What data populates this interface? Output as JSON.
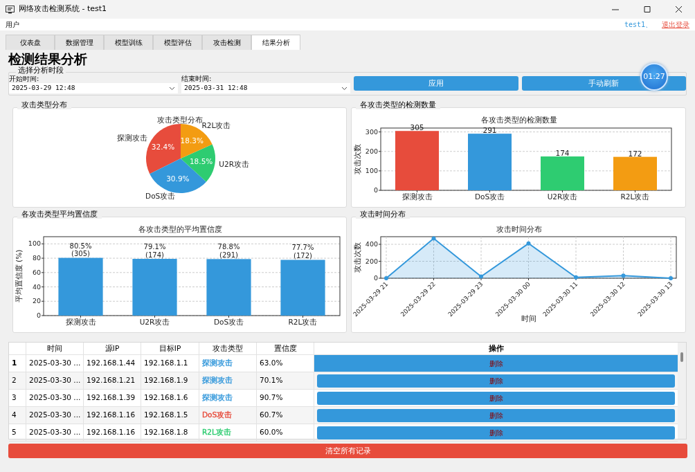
{
  "window": {
    "title": "网络攻击检测系统 - test1"
  },
  "menu_bar": {
    "items": [
      "用户"
    ],
    "user": "test1、",
    "logout": "退出登录"
  },
  "tabs": [
    {
      "label": "仪表盘",
      "selected": false
    },
    {
      "label": "数据管理",
      "selected": false
    },
    {
      "label": "模型训练",
      "selected": false
    },
    {
      "label": "模型评估",
      "selected": false
    },
    {
      "label": "攻击检测",
      "selected": false
    },
    {
      "label": "结果分析",
      "selected": true
    }
  ],
  "page_title": "检测结果分析",
  "period": {
    "title": "选择分析时段",
    "start_label": "开始时间:",
    "start_value": "2025-03-29 12:48",
    "end_label": "结束时间:",
    "end_value": "2025-03-31 12:48",
    "buttons": [
      "应用",
      "手动刷新"
    ]
  },
  "timer": "01:27",
  "panels": [
    {
      "title": "攻击类型分布",
      "chart_data": {
        "type": "pie",
        "title": "攻击类型分布",
        "categories": [
          "探测攻击",
          "DoS攻击",
          "U2R攻击",
          "R2L攻击"
        ],
        "colors": [
          "#e74c3c",
          "#3498db",
          "#2ecc71",
          "#f39c12"
        ],
        "values": [
          32.4,
          30.9,
          18.5,
          18.3
        ],
        "value_labels": [
          "32.4%",
          "30.9%",
          "18.5%",
          "18.3%"
        ]
      }
    },
    {
      "title": "各攻击类型的检测数量",
      "chart_data": {
        "type": "bar",
        "title": "各攻击类型的检测数量",
        "ylabel": "攻击次数",
        "categories": [
          "探测攻击",
          "DoS攻击",
          "U2R攻击",
          "R2L攻击"
        ],
        "colors": [
          "#e74c3c",
          "#3498db",
          "#2ecc71",
          "#f39c12"
        ],
        "values": [
          305,
          291,
          174,
          172
        ],
        "grid": true,
        "ylim": [
          0,
          320
        ],
        "yticks": [
          0,
          100,
          200,
          300
        ],
        "data_labels": true
      }
    },
    {
      "title": "各攻击类型平均置信度",
      "chart_data": {
        "type": "bar",
        "title": "各攻击类型的平均置信度",
        "ylabel": "平均置信度 (%)",
        "categories": [
          "探测攻击",
          "U2R攻击",
          "DoS攻击",
          "R2L攻击"
        ],
        "colors": [
          "#3498db",
          "#3498db",
          "#3498db",
          "#3498db"
        ],
        "values": [
          80.5,
          79.1,
          78.8,
          77.7
        ],
        "grid": true,
        "ylim": [
          0,
          110
        ],
        "yticks": [
          0,
          20,
          40,
          60,
          80,
          100
        ],
        "value_labels": [
          "80.5%\n(305)",
          "79.1%\n(174)",
          "78.8%\n(291)",
          "77.7%\n(172)"
        ]
      }
    },
    {
      "title": "攻击时间分布",
      "chart_data": {
        "type": "area",
        "title": "攻击时间分布",
        "xlabel": "时间",
        "ylabel": "攻击次数",
        "categories": [
          "2025-03-29 21",
          "2025-03-29 22",
          "2025-03-29 23",
          "2025-03-30 00",
          "2025-03-30 11",
          "2025-03-30 12",
          "2025-03-30 13"
        ],
        "series": [
          {
            "color": "#3498db",
            "values": [
              0,
              470,
              20,
              410,
              10,
              30,
              0
            ]
          }
        ],
        "grid": true,
        "ylim": [
          0,
          490
        ],
        "yticks": [
          0,
          200,
          400
        ]
      }
    }
  ],
  "table": {
    "columns": [
      "时间",
      "源IP",
      "目标IP",
      "攻击类型",
      "置信度",
      "操作"
    ],
    "rows": [
      {
        "number": "1",
        "selected": true,
        "time": "2025-03-30 ...",
        "source_ip": "192.168.1.44",
        "target_ip": "192.168.1.1",
        "attack_type": "探测攻击",
        "color": "#3498db",
        "confidence": "63.0%",
        "action": "删除"
      },
      {
        "number": "2",
        "selected": false,
        "time": "2025-03-30 ...",
        "source_ip": "192.168.1.21",
        "target_ip": "192.168.1.9",
        "attack_type": "探测攻击",
        "color": "#3498db",
        "confidence": "70.1%",
        "action": "删除"
      },
      {
        "number": "3",
        "selected": false,
        "time": "2025-03-30 ...",
        "source_ip": "192.168.1.39",
        "target_ip": "192.168.1.6",
        "attack_type": "探测攻击",
        "color": "#3498db",
        "confidence": "90.7%",
        "action": "删除"
      },
      {
        "number": "4",
        "selected": false,
        "time": "2025-03-30 ...",
        "source_ip": "192.168.1.16",
        "target_ip": "192.168.1.5",
        "attack_type": "DoS攻击",
        "color": "#e74c3c",
        "confidence": "60.7%",
        "action": "删除"
      },
      {
        "number": "5",
        "selected": false,
        "time": "2025-03-30 ...",
        "source_ip": "192.168.1.16",
        "target_ip": "192.168.1.8",
        "attack_type": "R2L攻击",
        "color": "#2ecc71",
        "confidence": "60.0%",
        "action": "删除"
      }
    ]
  },
  "clear_button": "清空所有记录"
}
